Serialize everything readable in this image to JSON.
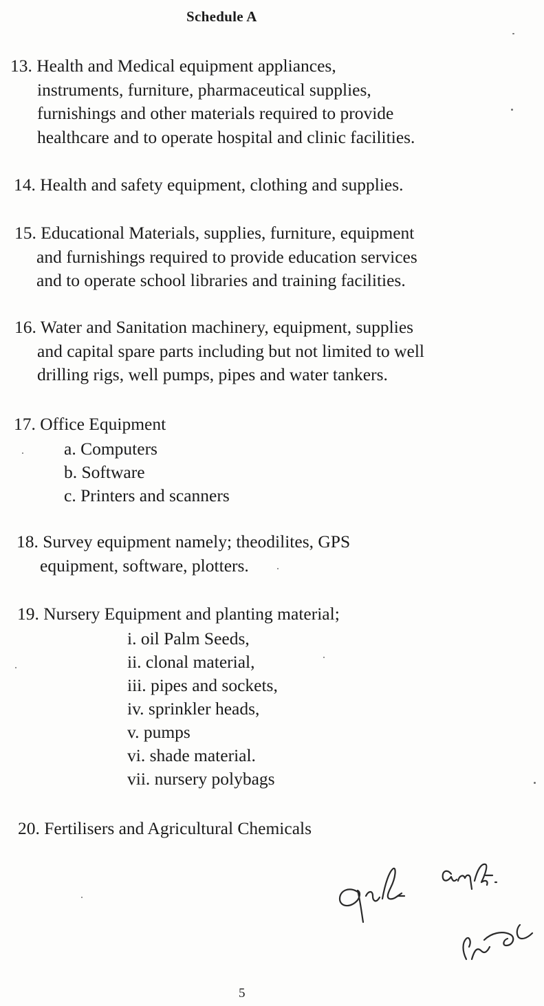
{
  "header": {
    "title": "Schedule A"
  },
  "items": [
    {
      "id": "13",
      "lines": [
        "13.  Health and Medical equipment appliances,",
        "instruments, furniture, pharmaceutical supplies,",
        "furnishings and other materials required to provide",
        "healthcare and to operate hospital and clinic facilities."
      ]
    },
    {
      "id": "14",
      "lines": [
        "14.  Health and safety  equipment, clothing and supplies."
      ]
    },
    {
      "id": "15",
      "lines": [
        "15.  Educational Materials, supplies, furniture, equipment",
        "and furnishings required to provide education services",
        "and to operate school libraries and training facilities."
      ]
    },
    {
      "id": "16",
      "lines": [
        "16.  Water and Sanitation machinery, equipment, supplies",
        "and capital spare parts including but not limited to well",
        "drilling rigs, well pumps, pipes and water tankers."
      ]
    },
    {
      "id": "17",
      "lines": [
        "17.  Office Equipment"
      ],
      "subitems": [
        "a.  Computers",
        "b.  Software",
        "c.  Printers and scanners"
      ]
    },
    {
      "id": "18",
      "lines": [
        "18.  Survey equipment namely; theodilites, GPS",
        "equipment, software, plotters."
      ]
    },
    {
      "id": "19",
      "lines": [
        "19.  Nursery Equipment and planting material;"
      ],
      "subitems": [
        "i.  oil Palm Seeds,",
        "ii. clonal material,",
        "iii. pipes and sockets,",
        "iv. sprinkler heads,",
        "v.  pumps",
        "vi. shade material.",
        "vii. nursery polybags"
      ]
    },
    {
      "id": "20",
      "lines": [
        "20.  Fertilisers and Agricultural Chemicals"
      ]
    }
  ],
  "footer": {
    "page_number": "5"
  }
}
